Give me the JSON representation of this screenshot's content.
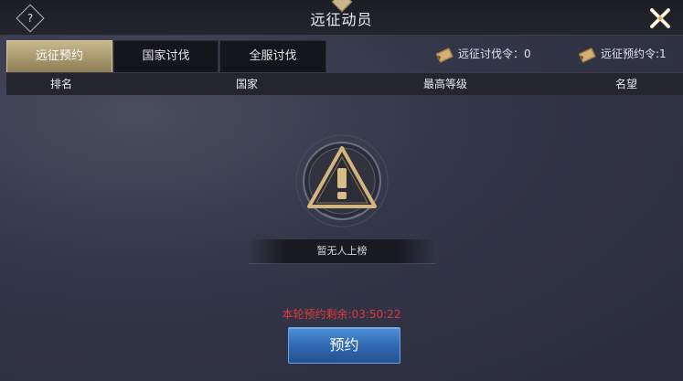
{
  "window": {
    "title": "远征动员"
  },
  "icons": {
    "help": "question-diamond-icon",
    "close": "close-x-icon",
    "scroll": "scroll-token-icon",
    "alert": "warning-triangle-icon"
  },
  "colors": {
    "active_tab": "#c9b98f",
    "accent_red": "#e23a35",
    "button_blue": "#3a78c4"
  },
  "help": {
    "glyph": "?"
  },
  "tabs": [
    {
      "label": "远征预约",
      "active": true
    },
    {
      "label": "国家讨伐",
      "active": false
    },
    {
      "label": "全服讨伐",
      "active": false
    }
  ],
  "counters": [
    {
      "label": "远征讨伐令：0"
    },
    {
      "label": "远征预约令:1"
    }
  ],
  "table": {
    "columns": [
      "排名",
      "国家",
      "最高等级",
      "名望"
    ]
  },
  "empty_state": {
    "text": "暂无人上榜"
  },
  "countdown": {
    "text": "本轮预约剩余:03:50:22"
  },
  "reserve_button": {
    "label": "预约"
  }
}
